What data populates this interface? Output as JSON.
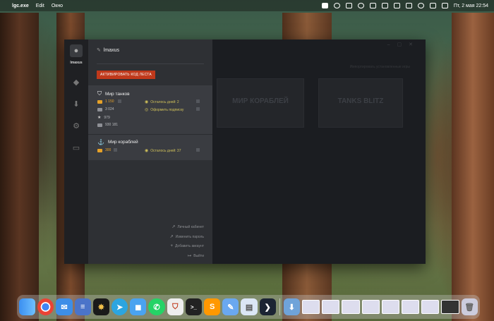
{
  "menubar": {
    "app_name": "lgc.exe",
    "menu_edit": "Edit",
    "menu_window": "Окно",
    "datetime": "Пт, 2 мая  22:54"
  },
  "sidebar": {
    "username": "lmaxus"
  },
  "panel": {
    "username": "lmaxus",
    "activate_label": "АКТИВИРОВАТЬ КОД ЛЕСТА",
    "games": [
      {
        "title": "Мир танков",
        "stats": [
          {
            "value": "1 150",
            "icon": "gold-icon",
            "color": "#e6a128"
          },
          {
            "value": "3 024",
            "icon": "credits-icon",
            "color": "#b7b9bd"
          },
          {
            "value": "979",
            "icon": "star-icon",
            "color": "#b7b9bd"
          },
          {
            "value": "930 181",
            "icon": "silver-icon",
            "color": "#b7b9bd"
          }
        ],
        "days_left": "Осталось дней: 2",
        "subscribe": "Оформить подписку"
      },
      {
        "title": "Мир кораблей",
        "stats": [
          {
            "value": "300",
            "icon": "doubloon-icon",
            "color": "#e6a128"
          }
        ],
        "days_left": "Осталось дней: 37"
      }
    ],
    "links": {
      "cabinet": "Личный кабинет",
      "change_password": "Изменить пароль",
      "add_account": "Добавить аккаунт",
      "logout": "Выйти"
    }
  },
  "content": {
    "search": "Импортировать установленные игры",
    "tiles": [
      "МИР КОРАБЛЕЙ",
      "TANKS BLITZ"
    ]
  },
  "colors": {
    "accent": "#c0391b",
    "gold": "#e6a128"
  }
}
